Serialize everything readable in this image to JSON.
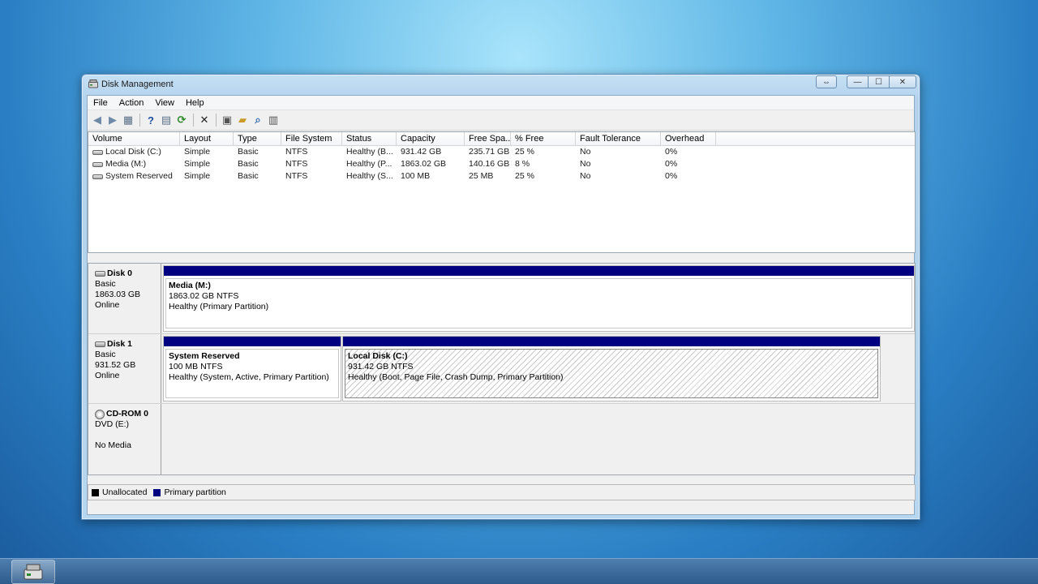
{
  "window": {
    "title": "Disk Management",
    "icon": "disk-management-icon"
  },
  "caption": {
    "restore": "⇔",
    "minimize": "—",
    "maximize": "☐",
    "close": "✕"
  },
  "menu": [
    "File",
    "Action",
    "View",
    "Help"
  ],
  "toolbar": {
    "buttons": [
      {
        "name": "back-icon",
        "glyph": "◀",
        "color": "#6f8aa8"
      },
      {
        "name": "forward-icon",
        "glyph": "▶",
        "color": "#6f8aa8"
      },
      {
        "name": "show-hide-tree-icon",
        "glyph": "▦",
        "color": "#5a6f88"
      },
      {
        "name": "help-icon",
        "glyph": "?",
        "color": "#1c4fa3"
      },
      {
        "name": "action-pane-icon",
        "glyph": "▤",
        "color": "#5a6f88"
      },
      {
        "name": "refresh-icon",
        "glyph": "⟳",
        "color": "#2a8a2a"
      },
      {
        "name": "delete-icon",
        "glyph": "✕",
        "color": "#222222"
      },
      {
        "name": "properties-icon",
        "glyph": "▣",
        "color": "#555555"
      },
      {
        "name": "open-icon",
        "glyph": "▰",
        "color": "#c89a2a"
      },
      {
        "name": "explore-icon",
        "glyph": "⌕",
        "color": "#3b6fb0"
      },
      {
        "name": "settings-icon",
        "glyph": "▥",
        "color": "#555555"
      }
    ]
  },
  "columns": [
    "Volume",
    "Layout",
    "Type",
    "File System",
    "Status",
    "Capacity",
    "Free Spa...",
    "% Free",
    "Fault Tolerance",
    "Overhead"
  ],
  "volumes": [
    {
      "volume": "Local Disk (C:)",
      "layout": "Simple",
      "type": "Basic",
      "fs": "NTFS",
      "status": "Healthy (B...",
      "capacity": "931.42 GB",
      "free": "235.71 GB",
      "pct": "25 %",
      "fault": "No",
      "overhead": "0%"
    },
    {
      "volume": "Media (M:)",
      "layout": "Simple",
      "type": "Basic",
      "fs": "NTFS",
      "status": "Healthy (P...",
      "capacity": "1863.02 GB",
      "free": "140.16 GB",
      "pct": "8 %",
      "fault": "No",
      "overhead": "0%"
    },
    {
      "volume": "System Reserved",
      "layout": "Simple",
      "type": "Basic",
      "fs": "NTFS",
      "status": "Healthy (S...",
      "capacity": "100 MB",
      "free": "25 MB",
      "pct": "25 %",
      "fault": "No",
      "overhead": "0%"
    }
  ],
  "disks": [
    {
      "name": "Disk 0",
      "type": "Basic",
      "size": "1863.03 GB",
      "state": "Online",
      "partitions": [
        {
          "name": "Media  (M:)",
          "size": "1863.02 GB NTFS",
          "status": "Healthy (Primary Partition)"
        }
      ]
    },
    {
      "name": "Disk 1",
      "type": "Basic",
      "size": "931.52 GB",
      "state": "Online",
      "partitions": [
        {
          "name": "System Reserved",
          "size": "100 MB NTFS",
          "status": "Healthy (System, Active, Primary Partition)"
        },
        {
          "name": "Local Disk  (C:)",
          "size": "931.42 GB NTFS",
          "status": "Healthy (Boot, Page File, Crash Dump, Primary Partition)"
        }
      ]
    },
    {
      "name": "CD-ROM 0",
      "type": "DVD (E:)",
      "size": "",
      "state": "No Media",
      "partitions": []
    }
  ],
  "legend": [
    {
      "label": "Unallocated",
      "color": "#000000"
    },
    {
      "label": "Primary partition",
      "color": "#000080"
    }
  ],
  "taskbar": {
    "app": "disk-management-icon"
  }
}
